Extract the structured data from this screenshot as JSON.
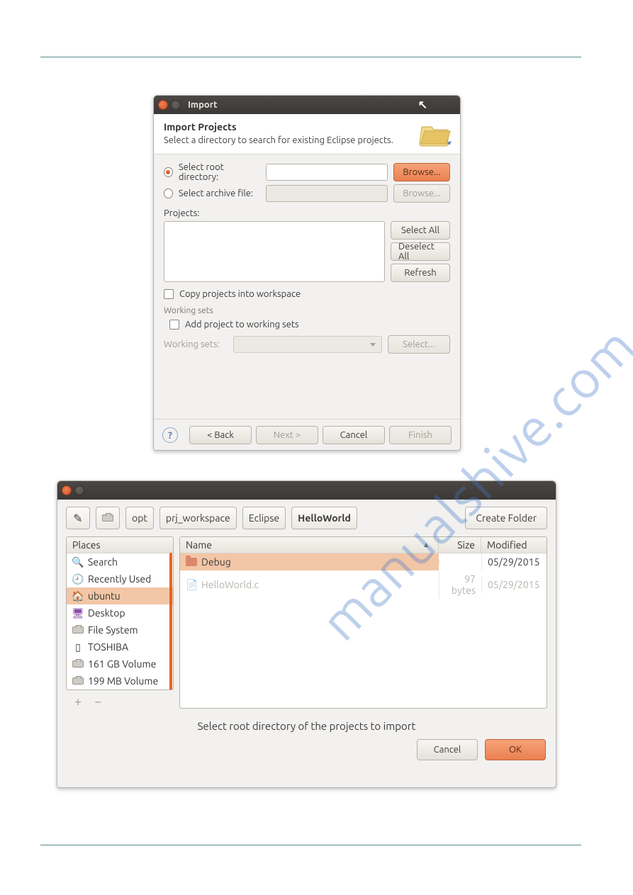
{
  "watermark": "manualshive.com",
  "import": {
    "window_title": "Import",
    "header_title": "Import Projects",
    "header_desc": "Select a directory to search for existing Eclipse projects.",
    "radio_root": "Select root directory:",
    "radio_archive": "Select archive file:",
    "browse": "Browse...",
    "projects_label": "Projects:",
    "btn_select_all": "Select All",
    "btn_deselect_all": "Deselect All",
    "btn_refresh": "Refresh",
    "cb_copy": "Copy projects into workspace",
    "working_sets_section": "Working sets",
    "cb_add_ws": "Add project to working sets",
    "ws_label": "Working sets:",
    "btn_select": "Select...",
    "btn_back": "< Back",
    "btn_next": "Next >",
    "btn_cancel": "Cancel",
    "btn_finish": "Finish"
  },
  "chooser": {
    "path": [
      "opt",
      "prj_workspace",
      "Eclipse",
      "HelloWorld"
    ],
    "create_folder": "Create Folder",
    "places_header": "Places",
    "places": [
      {
        "icon": "search",
        "label": "Search"
      },
      {
        "icon": "recent",
        "label": "Recently Used"
      },
      {
        "icon": "home",
        "label": "ubuntu"
      },
      {
        "icon": "desktop",
        "label": "Desktop"
      },
      {
        "icon": "disk",
        "label": "File System"
      },
      {
        "icon": "usb",
        "label": "TOSHIBA"
      },
      {
        "icon": "disk",
        "label": "161 GB Volume"
      },
      {
        "icon": "disk",
        "label": "199 MB Volume"
      }
    ],
    "cols": {
      "name": "Name",
      "size": "Size",
      "mod": "Modified"
    },
    "rows": [
      {
        "type": "folder",
        "name": "Debug",
        "size": "",
        "mod": "05/29/2015",
        "sel": true
      },
      {
        "type": "file",
        "name": "HelloWorld.c",
        "size": "97 bytes",
        "mod": "05/29/2015",
        "disabled": true
      }
    ],
    "message": "Select root directory of the projects to import",
    "btn_cancel": "Cancel",
    "btn_ok": "OK"
  }
}
